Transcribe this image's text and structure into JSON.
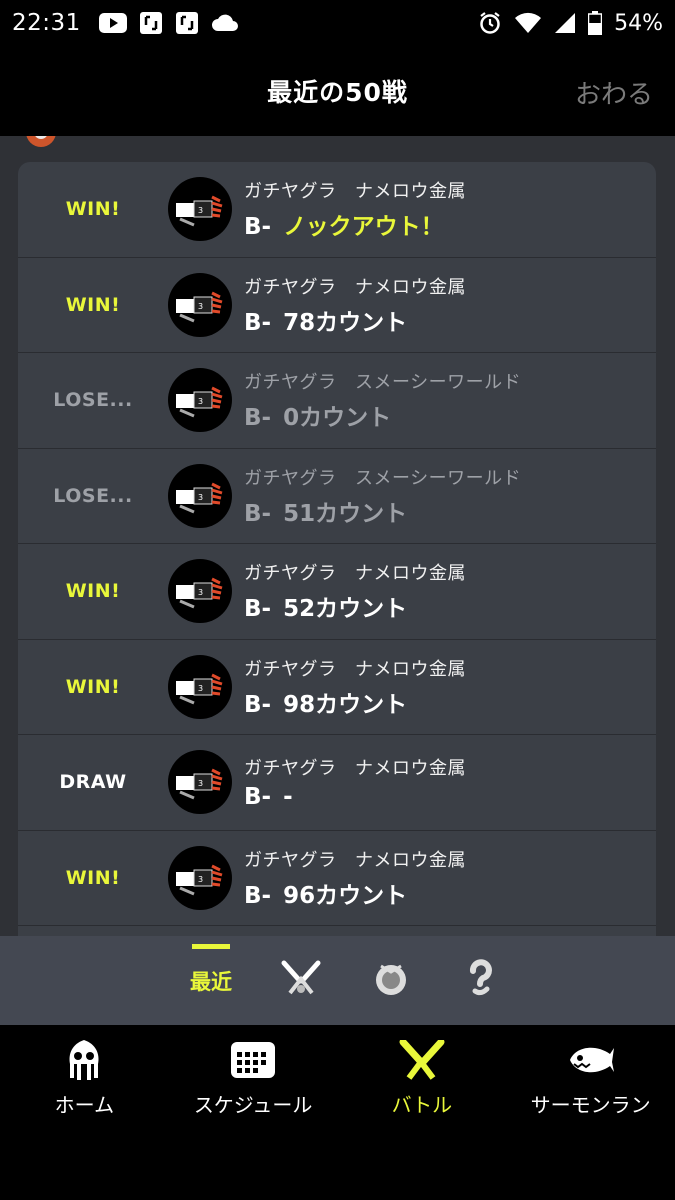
{
  "status": {
    "time": "22:31",
    "battery": "54%"
  },
  "header": {
    "title": "最近の50戦",
    "close_label": "おわる"
  },
  "results": [
    {
      "result": "WIN!",
      "kind": "win",
      "mode": "ガチヤグラ",
      "stage": "ナメロウ金属",
      "rank": "B-",
      "score": "ノックアウト！",
      "ko": true
    },
    {
      "result": "WIN!",
      "kind": "win",
      "mode": "ガチヤグラ",
      "stage": "ナメロウ金属",
      "rank": "B-",
      "score": "78カウント",
      "ko": false
    },
    {
      "result": "LOSE...",
      "kind": "lose",
      "mode": "ガチヤグラ",
      "stage": "スメーシーワールド",
      "rank": "B-",
      "score": "0カウント",
      "ko": false
    },
    {
      "result": "LOSE...",
      "kind": "lose",
      "mode": "ガチヤグラ",
      "stage": "スメーシーワールド",
      "rank": "B-",
      "score": "51カウント",
      "ko": false
    },
    {
      "result": "WIN!",
      "kind": "win",
      "mode": "ガチヤグラ",
      "stage": "ナメロウ金属",
      "rank": "B-",
      "score": "52カウント",
      "ko": false
    },
    {
      "result": "WIN!",
      "kind": "win",
      "mode": "ガチヤグラ",
      "stage": "ナメロウ金属",
      "rank": "B-",
      "score": "98カウント",
      "ko": false
    },
    {
      "result": "DRAW",
      "kind": "draw",
      "mode": "ガチヤグラ",
      "stage": "ナメロウ金属",
      "rank": "B-",
      "score": "-",
      "ko": false
    },
    {
      "result": "WIN!",
      "kind": "win",
      "mode": "ガチヤグラ",
      "stage": "ナメロウ金属",
      "rank": "B-",
      "score": "96カウント",
      "ko": false
    }
  ],
  "subtabs": {
    "recent_label": "最近",
    "icons": [
      "splat-icon",
      "rank-badge-icon",
      "question-icon"
    ]
  },
  "nav": [
    {
      "label": "ホーム",
      "icon": "squid-icon"
    },
    {
      "label": "スケジュール",
      "icon": "calendar-icon"
    },
    {
      "label": "バトル",
      "icon": "battle-icon"
    },
    {
      "label": "サーモンラン",
      "icon": "salmon-icon"
    }
  ],
  "colors": {
    "accent": "#e9f73a",
    "card": "#3b3f46",
    "background": "#2f3136"
  }
}
